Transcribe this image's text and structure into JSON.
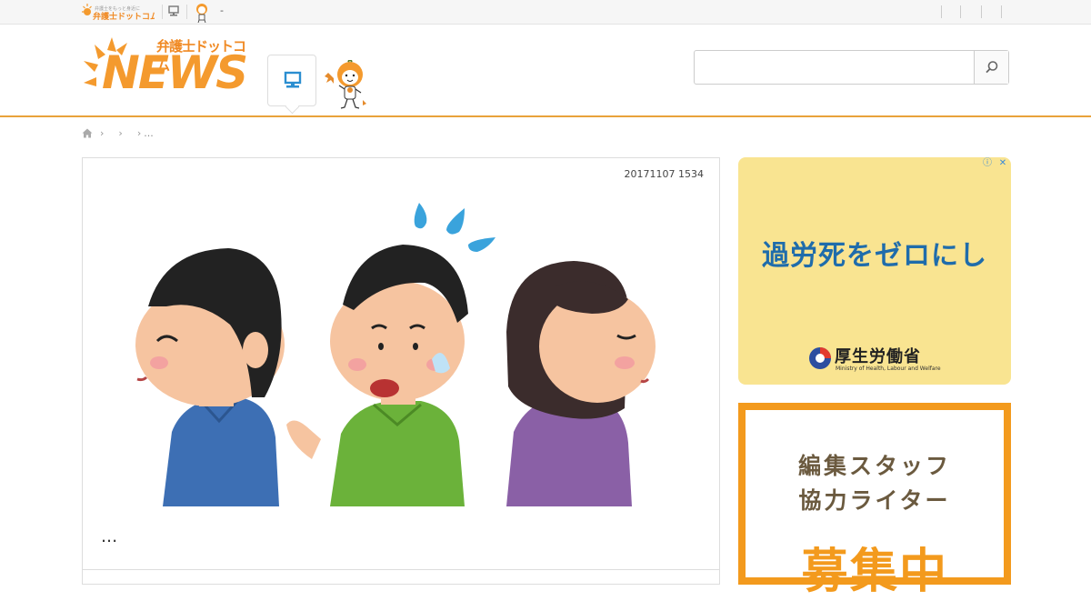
{
  "topbar": {
    "logo_text": "弁護士ドットコム",
    "dash": "-"
  },
  "header": {
    "logo_jp": "弁護士ドットコム",
    "logo_news": "NEWS",
    "search": {
      "value": "",
      "placeholder": ""
    }
  },
  "breadcrumb": {
    "sep": "›",
    "tail": "..."
  },
  "article": {
    "date": "20171107 1534",
    "title": "..."
  },
  "ads": {
    "ad1": {
      "copy": "過労死をゼロにし",
      "logo_main": "厚生労働省",
      "logo_sub": "Ministry of Health, Labour and Welfare"
    },
    "ad2": {
      "line1": "編集スタッフ",
      "line2": "協力ライター",
      "line3": "募集中"
    }
  },
  "colors": {
    "accent": "#f49a2e",
    "header_border": "#e9a23b",
    "ad1_bg": "#f9e491",
    "ad1_text": "#1f6cab",
    "ad2_border": "#f39a1d",
    "ad2_text": "#6b5a3f"
  }
}
